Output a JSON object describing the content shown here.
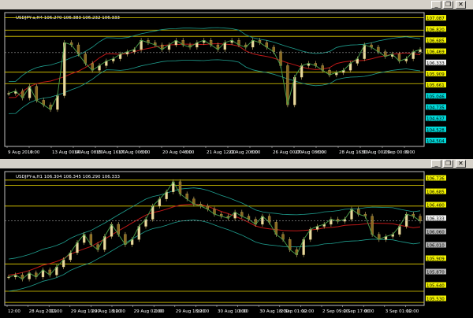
{
  "windows": [
    {
      "id": "h4",
      "header": "USDJPY-a,H4  106.270 106.383 106.232 106.333",
      "time_labels": [
        "9 Aug 2019",
        "6:00",
        "13 Aug 00:00",
        "14 Aug 08:00",
        "15 Aug 16:00",
        "17 Aug 00:00",
        "6:00",
        "20 Aug 04:00",
        "6:00",
        "21 Aug 12:00",
        "22 Aug 20:00",
        "6:00",
        "26 Aug 00:00",
        "27 Aug 08:00",
        "6:00",
        "28 Aug 16:00",
        "30 Aug 00:00",
        "2 Sep 00:00",
        "6:00"
      ],
      "price_labels": [
        "107.087",
        "106.820",
        "106.685",
        "106.469",
        "106.333",
        "105.909",
        "105.661",
        "105.046",
        "104.735",
        "104.637",
        "104.528",
        "104.504"
      ],
      "price_label_colors": [
        "#ffff00",
        "#ffff00",
        "#ffff00",
        "#ffff00",
        "#ffffff",
        "#ffff00",
        "#ffff00",
        "#00e5e5",
        "#00e5e5",
        "#00e5e5",
        "#00e5e5",
        "#00e5e5"
      ],
      "chart_data": {
        "type": "line",
        "title": "USDJPY-a,H4",
        "ylim": [
          104.3,
          107.2
        ],
        "last_price": 106.333,
        "horizontal_levels": [
          107.087,
          106.82,
          106.685,
          105.909,
          105.661
        ],
        "series": [
          {
            "values": [
              105.45,
              105.5,
              105.35,
              105.6,
              105.3,
              105.2,
              105.1,
              105.4,
              106.55,
              106.5,
              106.3,
              106.1,
              105.95,
              106.05,
              106.15,
              106.2,
              106.3,
              106.35,
              106.4,
              106.6,
              106.55,
              106.5,
              106.4,
              106.5,
              106.6,
              106.5,
              106.45,
              106.55,
              106.6,
              106.5,
              106.4,
              106.55,
              106.6,
              106.5,
              106.45,
              106.6,
              106.55,
              106.45,
              106.35,
              106.05,
              105.2,
              105.8,
              106.05,
              106.1,
              106.05,
              105.95,
              105.85,
              105.9,
              105.95,
              106.1,
              106.2,
              106.5,
              106.45,
              106.35,
              106.25,
              106.3,
              106.15,
              106.2,
              106.35,
              106.4
            ]
          }
        ]
      }
    },
    {
      "id": "h1",
      "header": "USDJPY-a,H1  106.304 106.345 106.290 106.333",
      "time_labels": [
        "12:00",
        "28 Aug 2019",
        "12:00",
        "29 Aug 10:00",
        "29 Aug 18:00",
        "12:00",
        "29 Aug 02:00",
        "0:00",
        "29 Aug 18:00",
        "12:00",
        "30 Aug 10:00",
        "0:00",
        "30 Aug 18:00",
        "2 Sep 01:00",
        "12:00",
        "2 Sep 09:00",
        "2 Sep 17:00",
        "0:00",
        "3 Sep 01:00",
        "12:00"
      ],
      "price_labels": [
        "106.736",
        "106.685",
        "106.480",
        "106.333",
        "106.060",
        "106.010",
        "105.909",
        "105.870",
        "105.640",
        "105.530"
      ],
      "price_label_colors": [
        "#ffff00",
        "#ffff00",
        "#ffff00",
        "#ffffff",
        "#c0c0c0",
        "#c0c0c0",
        "#ffff00",
        "#c0c0c0",
        "#ffff00",
        "#ffff00"
      ],
      "chart_data": {
        "type": "line",
        "title": "USDJPY-a,H1",
        "ylim": [
          105.5,
          106.82
        ],
        "last_price": 106.333,
        "horizontal_levels": [
          106.736,
          106.685,
          106.48,
          105.909,
          105.64,
          105.53
        ],
        "series": [
          {
            "values": [
              105.78,
              105.8,
              105.76,
              105.82,
              105.78,
              105.85,
              105.8,
              105.88,
              105.95,
              106.02,
              106.12,
              106.2,
              106.1,
              106.05,
              106.18,
              106.3,
              106.2,
              106.1,
              106.15,
              106.28,
              106.35,
              106.48,
              106.55,
              106.62,
              106.72,
              106.6,
              106.55,
              106.5,
              106.48,
              106.45,
              106.4,
              106.38,
              106.36,
              106.42,
              106.38,
              106.35,
              106.3,
              106.38,
              106.32,
              106.2,
              106.15,
              106.05,
              106.0,
              106.15,
              106.25,
              106.28,
              106.3,
              106.35,
              106.33,
              106.35,
              106.45,
              106.4,
              106.38,
              106.2,
              106.15,
              106.18,
              106.2,
              106.28,
              106.4,
              106.38,
              106.333
            ]
          }
        ]
      }
    }
  ]
}
